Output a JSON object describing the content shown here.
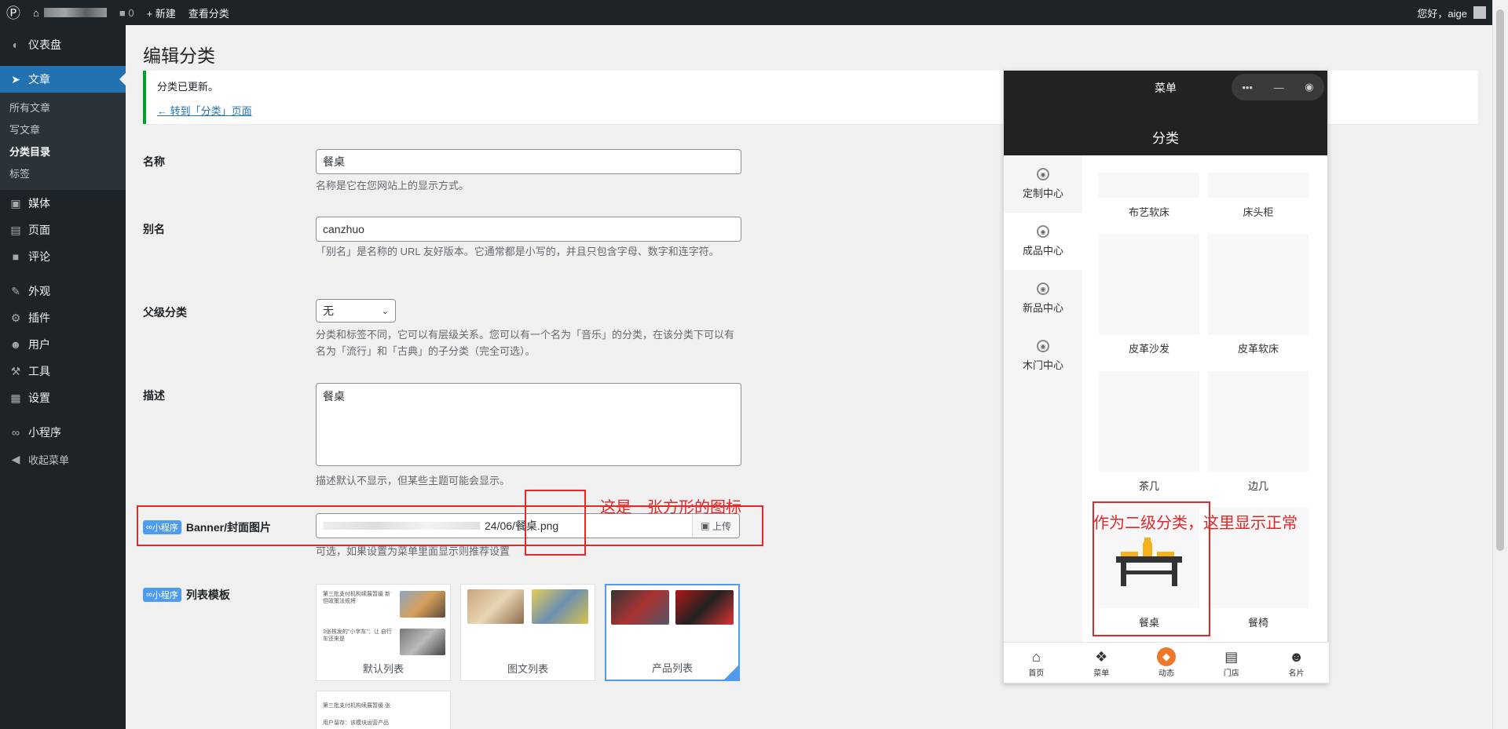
{
  "adminbar": {
    "comments": "0",
    "new": "+ 新建",
    "view": "查看分类",
    "greeting": "您好，aige"
  },
  "menu": {
    "dashboard": "仪表盘",
    "posts": "文章",
    "sub": [
      "所有文章",
      "写文章",
      "分类目录",
      "标签"
    ],
    "media": "媒体",
    "pages": "页面",
    "comments": "评论",
    "appearance": "外观",
    "plugins": "插件",
    "users": "用户",
    "tools": "工具",
    "settings": "设置",
    "miniapp": "小程序",
    "collapse": "收起菜单"
  },
  "page": {
    "title": "编辑分类"
  },
  "notice": {
    "text": "分类已更新。",
    "link": "← 转到「分类」页面"
  },
  "form": {
    "name_label": "名称",
    "name_value": "餐桌",
    "name_desc": "名称是它在您网站上的显示方式。",
    "slug_label": "别名",
    "slug_value": "canzhuo",
    "slug_desc": "「别名」是名称的 URL 友好版本。它通常都是小写的，并且只包含字母、数字和连字符。",
    "parent_label": "父级分类",
    "parent_value": "无",
    "parent_desc": "分类和标签不同，它可以有层级关系。您可以有一个名为「音乐」的分类，在该分类下可以有名为「流行」和「古典」的子分类（完全可选）。",
    "desc_label": "描述",
    "desc_value": "餐桌",
    "desc_desc": "描述默认不显示，但某些主题可能会显示。",
    "badge": "小程序",
    "banner_label": "Banner/封面图片",
    "banner_value": "24/06/餐桌.png",
    "upload": "上传",
    "banner_desc": "可选，如果设置为菜单里面显示则推荐设置",
    "list_label": "列表模板",
    "templates": [
      "默认列表",
      "图文列表",
      "产品列表"
    ]
  },
  "annotations": {
    "a1": "这是一张方形的图标",
    "a2": "作为二级分类，这里显示正常"
  },
  "phone": {
    "menu_title": "菜单",
    "page_title": "分类",
    "left": [
      "定制中心",
      "成品中心",
      "新品中心",
      "木门中心"
    ],
    "grid": [
      "布艺软床",
      "床头柜",
      "皮革沙发",
      "皮革软床",
      "茶几",
      "边几",
      "餐桌",
      "餐椅"
    ],
    "tabs": [
      "首页",
      "菜单",
      "动态",
      "门店",
      "名片"
    ]
  },
  "tpl_text": {
    "t1a": "第三批支付机构续展暂缓 新 但政策法规将",
    "t1b": "3张核发的\"小字车\"：让 自行车还来是",
    "t4a": "第三批支付机构续展暂缓 张",
    "t4b": "用户留存：该模块运营产品"
  }
}
